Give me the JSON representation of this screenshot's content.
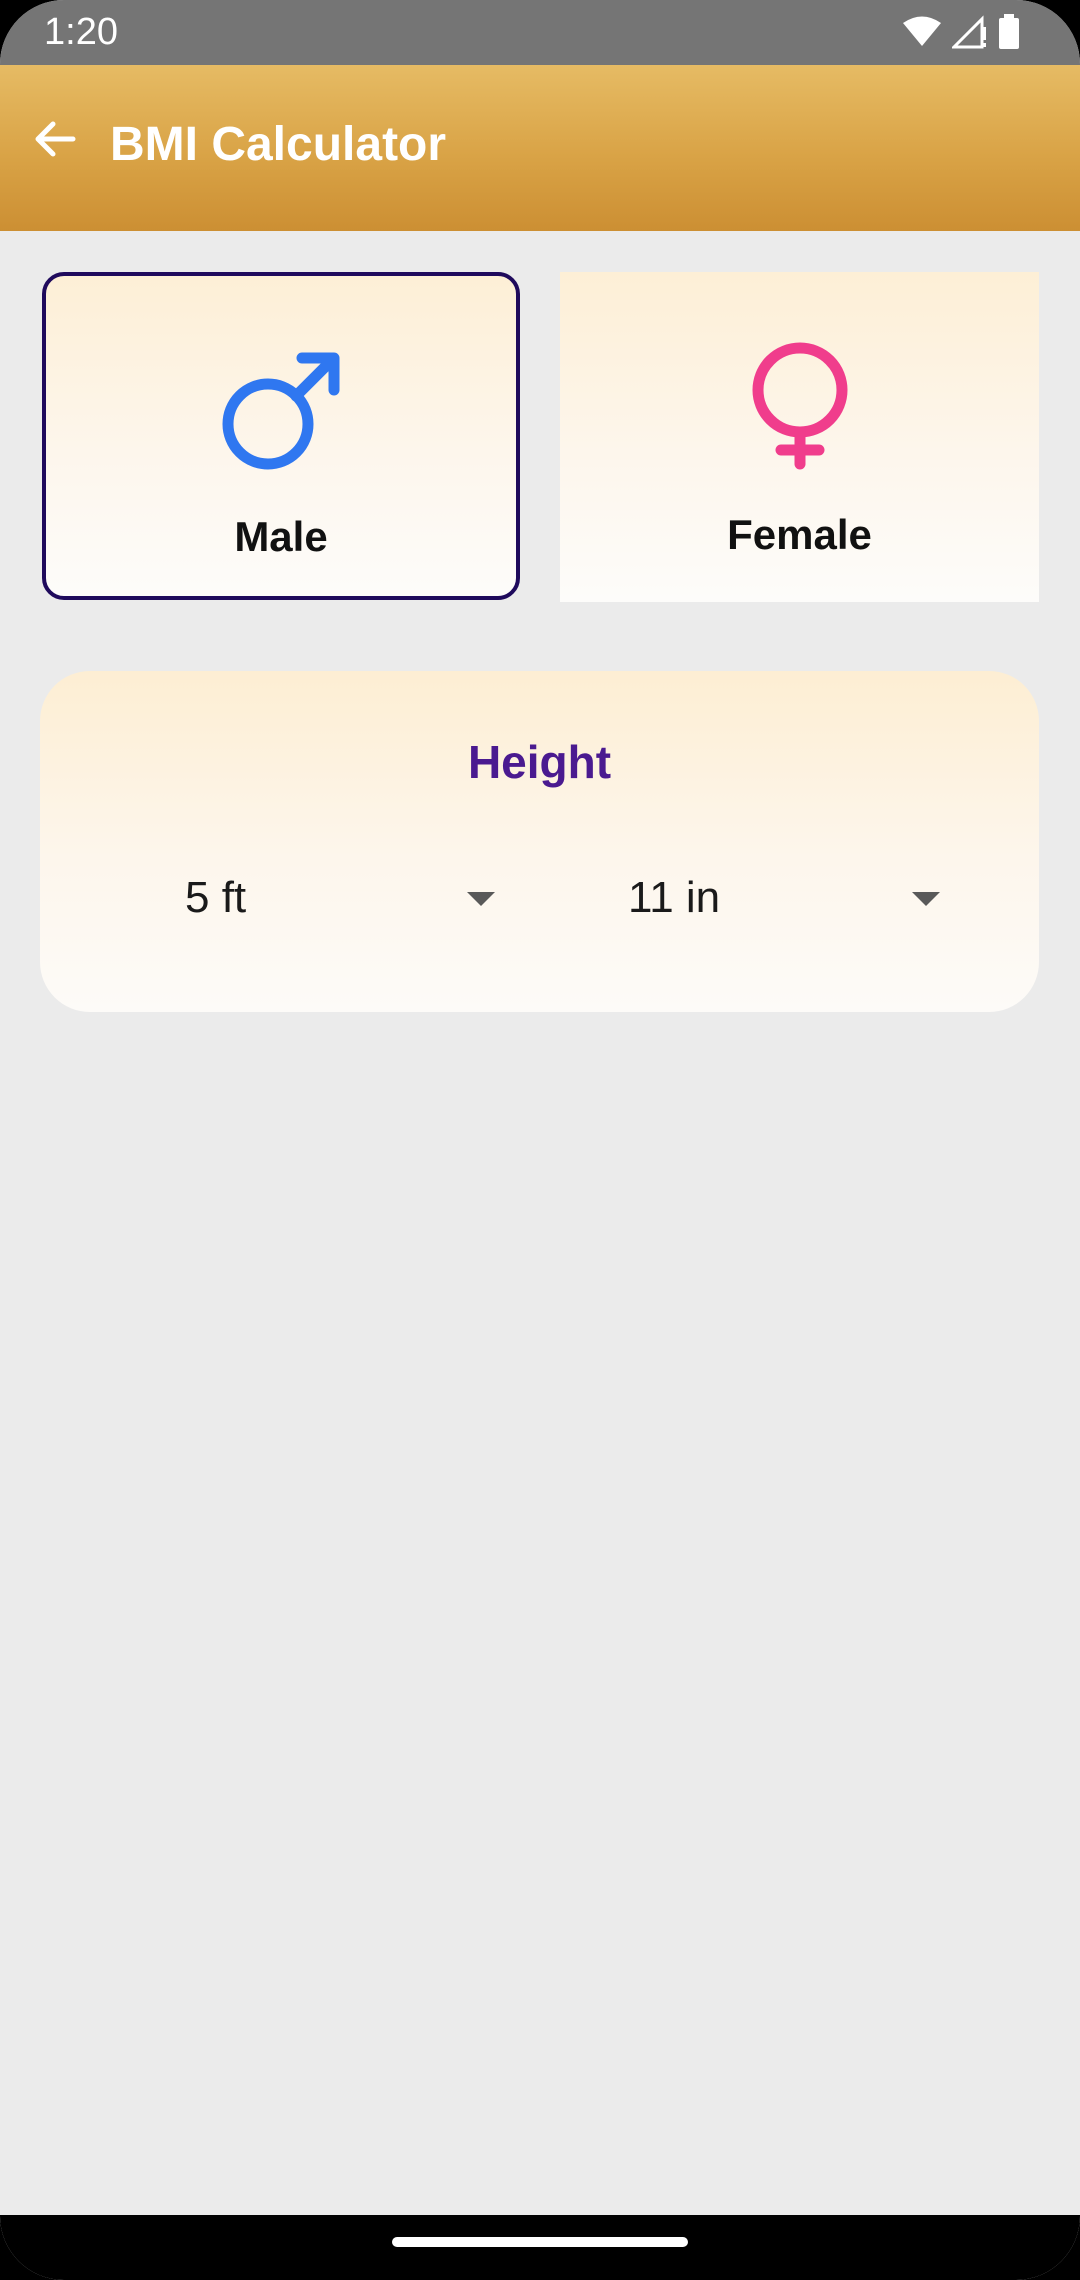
{
  "status_bar": {
    "time": "1:20",
    "icons": [
      "wifi-icon",
      "cellular-signal-icon",
      "battery-icon"
    ]
  },
  "app_bar": {
    "back_icon": "arrow-left-icon",
    "title": "BMI Calculator",
    "gradient_top": "#e6bb64",
    "gradient_bottom": "#cc8f33"
  },
  "gender": {
    "selected": "male",
    "male": {
      "label": "Male",
      "icon": "male-symbol-icon",
      "icon_color": "#2f77f0"
    },
    "female": {
      "label": "Female",
      "icon": "female-symbol-icon",
      "icon_color": "#f03d8c"
    }
  },
  "height": {
    "title": "Height",
    "title_color": "#4a1a90",
    "feet": {
      "value": "5 ft"
    },
    "inches": {
      "value": "11 in"
    }
  },
  "colors": {
    "background": "#ebebeb",
    "selected_border": "#1f0a5c"
  }
}
